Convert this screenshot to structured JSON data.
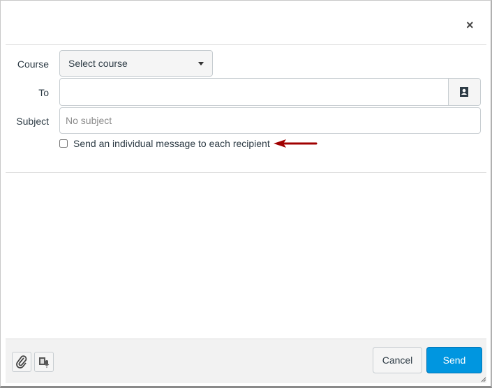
{
  "dialog": {
    "close_label": "×"
  },
  "form": {
    "course_label": "Course",
    "course_value": "Select course",
    "to_label": "To",
    "to_value": "",
    "subject_label": "Subject",
    "subject_placeholder": "No subject",
    "individual_label": "Send an individual message to each recipient"
  },
  "footer": {
    "cancel_label": "Cancel",
    "send_label": "Send"
  },
  "colors": {
    "accent": "#0096e0",
    "arrow": "#a00000"
  }
}
